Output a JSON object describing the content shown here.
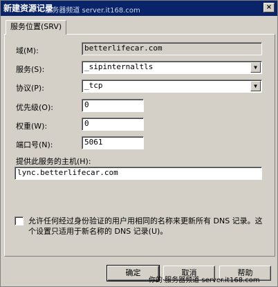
{
  "window": {
    "title": "新建资源记录",
    "watermark": "· 服务器频道 server.it168.com",
    "close_label": "×"
  },
  "tabs": [
    {
      "label": "服务位置(SRV)",
      "active": true
    }
  ],
  "form": {
    "domain": {
      "label": "域(M):",
      "value": "betterlifecar.com"
    },
    "service": {
      "label": "服务(S):",
      "value": "_sipinternaltls"
    },
    "protocol": {
      "label": "协议(P):",
      "value": "_tcp"
    },
    "priority": {
      "label": "优先级(O):",
      "value": "0"
    },
    "weight": {
      "label": "权重(W):",
      "value": "0"
    },
    "port": {
      "label": "端口号(N):",
      "value": "5061"
    },
    "host": {
      "label": "提供此服务的主机(H):",
      "value": "lync.betterlifecar.com"
    },
    "allow_update": {
      "label": "允许任何经过身份验证的用户用相同的名称来更新所有 DNS 记录。这个设置只适用于新名称的 DNS 记录(U)。",
      "checked": false
    }
  },
  "buttons": {
    "ok": "确定",
    "cancel": "取消",
    "help": "帮助"
  },
  "footer_watermark": "你的·服务器频道 server.it168.com",
  "icons": {
    "combo_arrow": "chevron-down-icon"
  }
}
